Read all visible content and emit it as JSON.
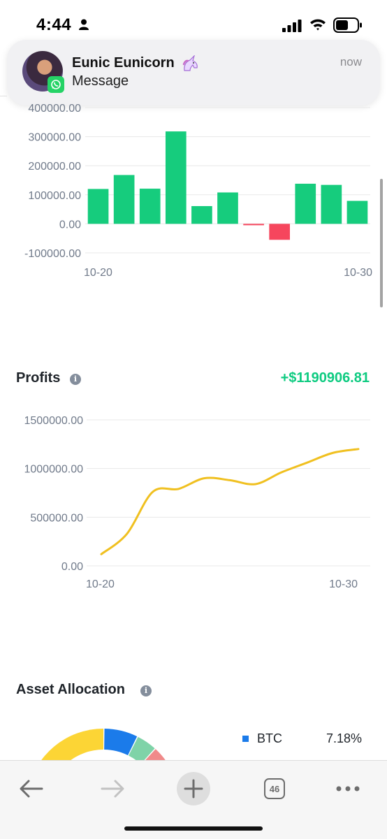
{
  "status_bar": {
    "time": "4:44"
  },
  "notification": {
    "title": "Eunic Eunicorn",
    "body": "Message",
    "time": "now",
    "app_icon": "whatsapp-icon",
    "emoji_icon": "unicorn-icon"
  },
  "chart_data": [
    {
      "type": "bar",
      "x": [
        "10-20",
        "10-21",
        "10-22",
        "10-23",
        "10-24",
        "10-25",
        "10-26",
        "10-27",
        "10-28",
        "10-29",
        "10-30"
      ],
      "values": [
        120000,
        168000,
        121000,
        318000,
        61000,
        108000,
        -3000,
        -55000,
        138000,
        134000,
        79000
      ],
      "y_ticks": [
        "400000.00",
        "300000.00",
        "200000.00",
        "100000.00",
        "0.00",
        "-100000.00"
      ],
      "x_tick_labels": [
        "10-20",
        "10-30"
      ],
      "ylim": [
        -100000,
        400000
      ],
      "colors": {
        "positive": "#16cc7d",
        "negative": "#f6465d"
      },
      "grid": true
    },
    {
      "type": "line",
      "title": "Profits",
      "total": "+$1190906.81",
      "x": [
        "10-20",
        "10-21",
        "10-22",
        "10-23",
        "10-24",
        "10-25",
        "10-26",
        "10-27",
        "10-28",
        "10-29",
        "10-30"
      ],
      "values": [
        120000,
        330000,
        760000,
        790000,
        900000,
        880000,
        840000,
        960000,
        1060000,
        1160000,
        1200000
      ],
      "y_ticks": [
        "1500000.00",
        "1000000.00",
        "500000.00",
        "0.00"
      ],
      "x_tick_labels": [
        "10-20",
        "10-30"
      ],
      "ylim": [
        0,
        1500000
      ],
      "color": "#f0c020",
      "grid": true
    }
  ],
  "asset_allocation": {
    "title": "Asset Allocation",
    "legend": [
      {
        "name": "BTC",
        "percent": "7.18%",
        "color": "#1b7bea"
      }
    ],
    "donut_colors": [
      "#fcd535",
      "#1b7bea",
      "#7fd3a8",
      "#f08a8a"
    ]
  },
  "toolbar": {
    "tab_count": "46"
  }
}
